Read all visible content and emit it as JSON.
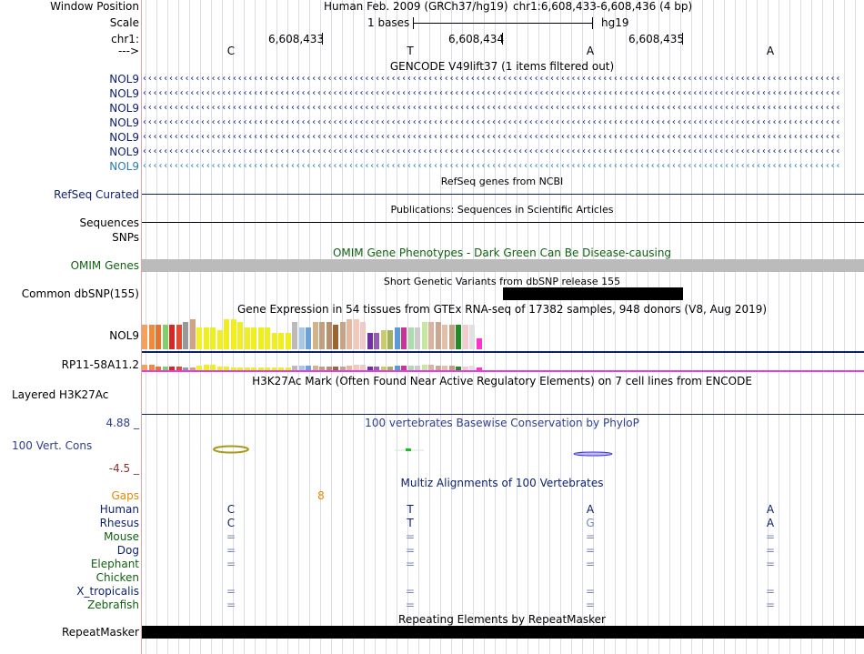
{
  "header": {
    "window_position_label": "Window Position",
    "assembly": "Human Feb. 2009 (GRCh37/hg19)",
    "position": "chr1:6,608,433-6,608,436 (4 bp)",
    "scale_label": "Scale",
    "scale_text": "1 bases",
    "scale_db": "hg19",
    "chrom_label": "chr1:",
    "coords": [
      "6,608,433",
      "6,608,434",
      "6,608,435"
    ],
    "strand_label": "--->",
    "bases": [
      "C",
      "T",
      "A",
      "A"
    ]
  },
  "tracks": {
    "gencode": {
      "title": "GENCODE V49lift37 (1 items filtered out)",
      "items": [
        "NOL9",
        "NOL9",
        "NOL9",
        "NOL9",
        "NOL9",
        "NOL9",
        "NOL9"
      ]
    },
    "refseq": {
      "title": "RefSeq genes from NCBI",
      "label": "RefSeq Curated"
    },
    "publications": {
      "title": "Publications: Sequences in Scientific Articles",
      "label": "Sequences"
    },
    "snps_label": "SNPs",
    "omim": {
      "title": "OMIM Gene Phenotypes - Dark Green Can Be Disease-causing",
      "label": "OMIM Genes"
    },
    "dbsnp": {
      "title": "Short Genetic Variants from dbSNP release 155",
      "label": "Common dbSNP(155)"
    },
    "gtex": {
      "title": "Gene Expression in 54 tissues from GTEx RNA-seq of 17382 samples, 948 donors (V8, Aug 2019)",
      "genes": [
        "NOL9",
        "RP11-58A11.2"
      ],
      "tissue_colors": [
        "#f6a15b",
        "#f08a3e",
        "#e8742d",
        "#7fcf6b",
        "#d62728",
        "#e34a33",
        "#999999",
        "#cfa383",
        "#f2ef2b",
        "#eeee22",
        "#eeee22",
        "#eeee22",
        "#eeee22",
        "#eeee22",
        "#eeee22",
        "#eeee22",
        "#eeee22",
        "#eeee22",
        "#eeee22",
        "#eeee22",
        "#eeee22",
        "#eeee22",
        "#bbbbbb",
        "#a7c7e7",
        "#6fa0d8",
        "#d2b48c",
        "#c0a080",
        "#b89070",
        "#996633",
        "#c6a48c",
        "#e6b8a0",
        "#f2c8b8",
        "#eec9c9",
        "#7030a0",
        "#9b59b6",
        "#cccc66",
        "#a0b060",
        "#5b9bd5",
        "#cc3399",
        "#aaddaa",
        "#cccccc",
        "#c7e6a0",
        "#d8b4a0",
        "#c8a890",
        "#e0c0a8",
        "#bfa080",
        "#228b22",
        "#f4cccc",
        "#e0e0e0",
        "#ff33cc"
      ],
      "nol9_heights": [
        27,
        27,
        27,
        27,
        27,
        27,
        30,
        33,
        24,
        24,
        24,
        21,
        33,
        33,
        30,
        24,
        24,
        24,
        24,
        18,
        18,
        18,
        30,
        24,
        24,
        30,
        30,
        30,
        27,
        30,
        33,
        33,
        30,
        18,
        18,
        21,
        21,
        24,
        24,
        24,
        24,
        30,
        30,
        30,
        27,
        27,
        27,
        27,
        27,
        12
      ],
      "rp11_heights": [
        6,
        6,
        4,
        4,
        4,
        4,
        3,
        3,
        5,
        6,
        6,
        4,
        4,
        3,
        3,
        3,
        3,
        3,
        3,
        3,
        3,
        3,
        5,
        5,
        5,
        5,
        4,
        4,
        4,
        4,
        5,
        6,
        6,
        4,
        4,
        4,
        4,
        5,
        5,
        5,
        5,
        6,
        6,
        5,
        5,
        5,
        4,
        4,
        5,
        3
      ]
    },
    "h3k27ac": {
      "title": "H3K27Ac Mark (Often Found Near Active Regulatory Elements) on 7 cell lines from ENCODE",
      "label": "Layered H3K27Ac"
    },
    "phylop": {
      "title": "100 vertebrates Basewise Conservation by PhyloP",
      "label": "100 Vert. Cons",
      "max": "4.88 _",
      "min": "-4.5 _"
    },
    "multiz": {
      "title": "Multiz Alignments of 100 Vertebrates",
      "gaps_label": "Gaps",
      "gaps_value": "8",
      "species": [
        {
          "name": "Human",
          "bases": [
            "C",
            "T",
            "A",
            "A"
          ],
          "color": "navy"
        },
        {
          "name": "Rhesus",
          "bases": [
            "C",
            "T",
            "G",
            "A"
          ],
          "color": "navy"
        },
        {
          "name": "Mouse",
          "bases": [
            "=",
            "=",
            "=",
            "="
          ],
          "color": "grn"
        },
        {
          "name": "Dog",
          "bases": [
            "=",
            "=",
            "=",
            "="
          ],
          "color": "navy"
        },
        {
          "name": "Elephant",
          "bases": [
            "=",
            "=",
            "=",
            "="
          ],
          "color": "grn"
        },
        {
          "name": "Chicken",
          "bases": [
            "",
            "",
            "",
            ""
          ],
          "color": "grn"
        },
        {
          "name": "X_tropicalis",
          "bases": [
            "=",
            "=",
            "=",
            "="
          ],
          "color": "navy"
        },
        {
          "name": "Zebrafish",
          "bases": [
            "=",
            "=",
            "=",
            "="
          ],
          "color": "grn"
        }
      ]
    },
    "repeatmasker": {
      "title": "Repeating Elements by RepeatMasker",
      "label": "RepeatMasker"
    }
  },
  "colors": {
    "navy": "#0b1f6e",
    "gencode_last": "#2a7ab0",
    "omim": "#bbbbbb",
    "track_line": "#0b1f6e",
    "gaps": "#e08a00",
    "phylop_max": "#2c3e8f",
    "phylop_min": "#8b2e2e"
  }
}
